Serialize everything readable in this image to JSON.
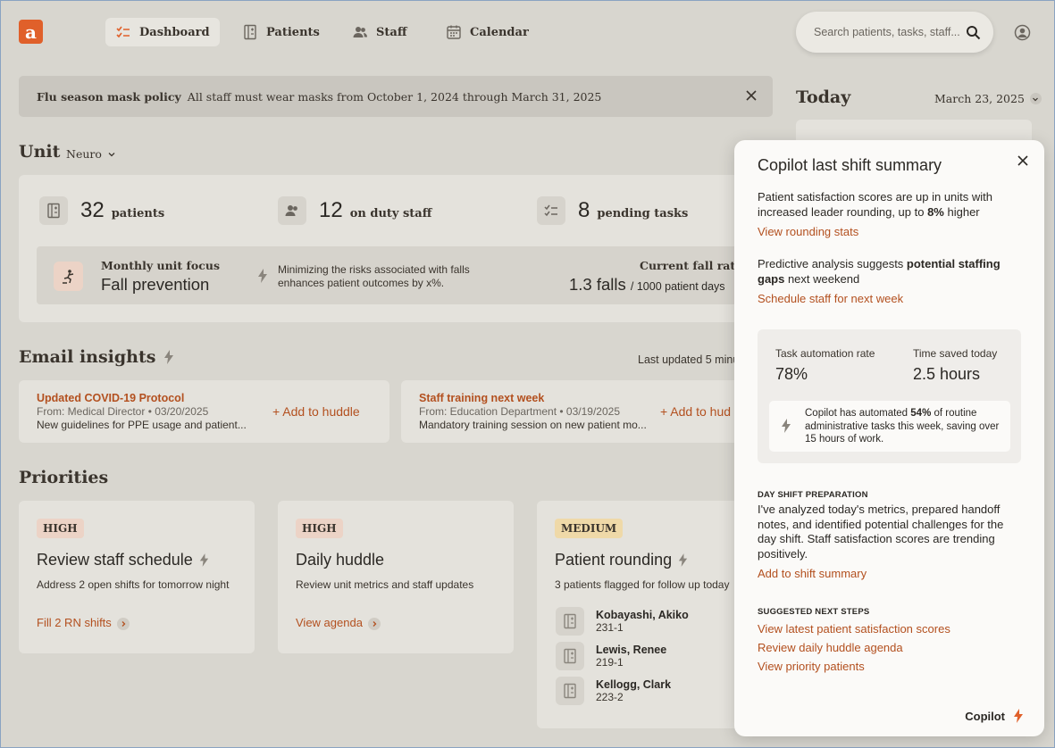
{
  "header": {
    "logo": "a",
    "nav": [
      {
        "label": "Dashboard",
        "icon": "checklist-icon"
      },
      {
        "label": "Patients",
        "icon": "patients-icon"
      },
      {
        "label": "Staff",
        "icon": "people-icon"
      },
      {
        "label": "Calendar",
        "icon": "calendar-icon"
      }
    ],
    "search_placeholder": "Search patients, tasks, staff..."
  },
  "banner": {
    "title": "Flu season mask policy",
    "text": "All staff must wear masks from October 1, 2024 through March 31, 2025"
  },
  "unit": {
    "heading": "Unit",
    "selected": "Neuro"
  },
  "stats": [
    {
      "num": "32",
      "label": "patients"
    },
    {
      "num": "12",
      "label": "on duty staff"
    },
    {
      "num": "8",
      "label": "pending tasks"
    }
  ],
  "focus": {
    "caption": "Monthly unit focus",
    "title": "Fall prevention",
    "desc": "Minimizing the risks associated with falls enhances patient outcomes by x%.",
    "rate_label": "Current fall rate",
    "rate_value": "1.3 falls",
    "rate_unit": "1000 patient days"
  },
  "email": {
    "heading": "Email insights",
    "updated": "Last updated 5 minu",
    "items": [
      {
        "title": "Updated COVID-19 Protocol",
        "from": "From: Medical Director • 03/20/2025",
        "body": "New guidelines for PPE usage and patient...",
        "action": "+ Add to huddle"
      },
      {
        "title": "Staff training next week",
        "from": "From: Education Department • 03/19/2025",
        "body": "Mandatory training session on new patient mo...",
        "action": "+ Add to hud"
      }
    ]
  },
  "priorities": {
    "heading": "Priorities",
    "cards": [
      {
        "badge": "HIGH",
        "title": "Review staff schedule",
        "desc": "Address 2 open shifts for tomorrow night",
        "link": "Fill 2 RN shifts"
      },
      {
        "badge": "HIGH",
        "title": "Daily huddle",
        "desc": "Review unit metrics and staff updates",
        "link": "View agenda"
      },
      {
        "badge": "MEDIUM",
        "title": "Patient rounding",
        "desc": "3 patients flagged for follow up today",
        "patients": [
          {
            "name": "Kobayashi, Akiko",
            "room": "231-1"
          },
          {
            "name": "Lewis, Renee",
            "room": "219-1"
          },
          {
            "name": "Kellogg, Clark",
            "room": "223-2"
          }
        ]
      }
    ]
  },
  "today": {
    "heading": "Today",
    "date": "March 23, 2025"
  },
  "copilot": {
    "title": "Copilot last shift summary",
    "p1_a": "Patient satisfaction scores are up in units with increased leader rounding, up to ",
    "p1_b": "8%",
    "p1_c": " higher",
    "link1": "View rounding stats",
    "p2_a": "Predictive analysis suggests ",
    "p2_b": "potential staffing gaps",
    "p2_c": " next weekend",
    "link2": "Schedule staff for next week",
    "metric1_label": "Task automation rate",
    "metric1_value": "78%",
    "metric2_label": "Time saved today",
    "metric2_value": "2.5 hours",
    "note_a": "Copilot has automated ",
    "note_b": "54%",
    "note_c": " of routine administrative tasks this week, saving over 15 hours of work.",
    "prep_caption": "DAY SHIFT PREPARATION",
    "prep_text": "I've analyzed today's metrics, prepared handoff notes, and identified potential challenges for the day shift. Staff satisfaction scores are trending positively.",
    "prep_link": "Add to shift summary",
    "next_caption": "SUGGESTED NEXT STEPS",
    "next_links": [
      "View latest patient satisfaction scores",
      "Review daily huddle agenda",
      "View priority patients"
    ],
    "footer": "Copilot"
  },
  "colors": {
    "accent": "#e0602a",
    "link": "#b3501f",
    "high_badge": "#ecd3c6",
    "medium_badge": "#efd9a8"
  }
}
